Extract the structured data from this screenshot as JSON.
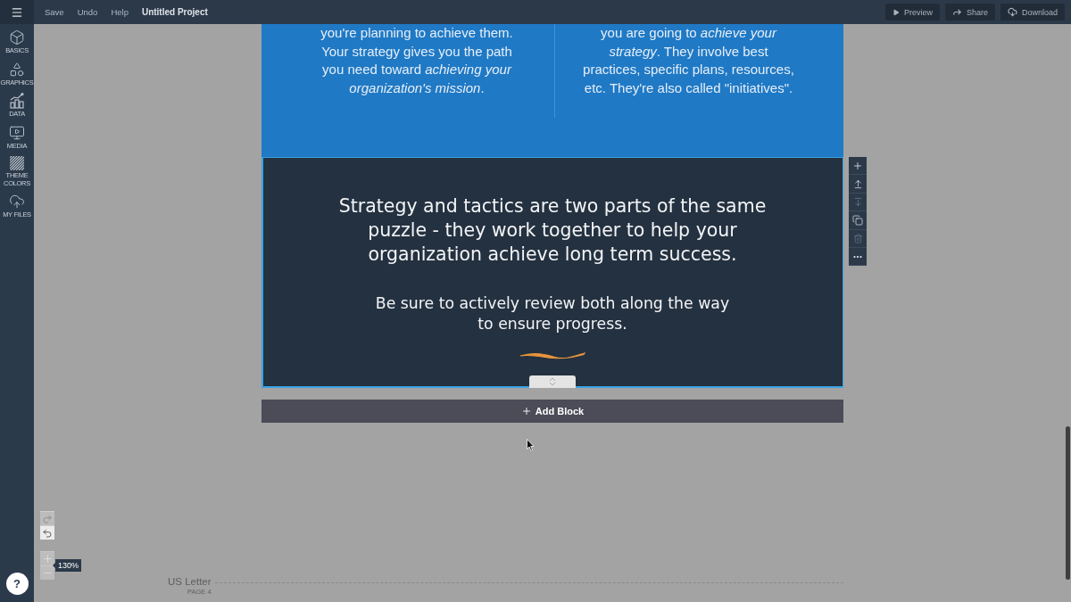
{
  "top_bar": {
    "menu": [
      {
        "label": "Save"
      },
      {
        "label": "Undo"
      },
      {
        "label": "Help"
      }
    ],
    "project_title": "Untitled Project",
    "actions": [
      {
        "kind": "preview",
        "label": "Preview"
      },
      {
        "kind": "share",
        "label": "Share"
      },
      {
        "kind": "download",
        "label": "Download"
      }
    ]
  },
  "sidebar": {
    "items": [
      {
        "kind": "basics",
        "label": "BASICS"
      },
      {
        "kind": "graphics",
        "label": "GRAPHICS"
      },
      {
        "kind": "data",
        "label": "DATA"
      },
      {
        "kind": "media",
        "label": "MEDIA"
      },
      {
        "kind": "theme_colors",
        "label": "THEME COLORS"
      },
      {
        "kind": "my_files",
        "label": "MY FILES"
      }
    ],
    "help_button": {
      "label": "?"
    }
  },
  "blocks": [
    {
      "kind": "two_column",
      "selected": false,
      "columns": [
        {
          "lines": [
            "you're planning to achieve them.",
            "Your strategy gives you the path",
            "you need toward *achieving your*",
            "*organization's mission*."
          ]
        },
        {
          "lines": [
            "you are going to *achieve your*",
            "*strategy*. They involve best",
            "practices, specific plans, resources,",
            "etc. They're also called \"initiatives\"."
          ]
        }
      ]
    },
    {
      "kind": "callout",
      "selected": true,
      "paragraphs": [
        {
          "kind": "lead",
          "lines": [
            "Strategy and tactics are two parts of the same",
            "puzzle - they work together to help your",
            "organization achieve long term success."
          ]
        },
        {
          "kind": "note",
          "lines": [
            "Be sure to actively review both along the way",
            "to ensure progress."
          ]
        }
      ]
    }
  ],
  "block_toolbar": [
    {
      "kind": "add",
      "disabled": false
    },
    {
      "kind": "move_up",
      "disabled": false
    },
    {
      "kind": "move_down",
      "disabled": true
    },
    {
      "kind": "duplicate",
      "disabled": false
    },
    {
      "kind": "delete",
      "disabled": true
    },
    {
      "kind": "more",
      "disabled": false
    }
  ],
  "add_block": {
    "label": "Add Block"
  },
  "history": [
    {
      "kind": "redo",
      "disabled": true
    },
    {
      "kind": "undo",
      "disabled": false
    }
  ],
  "zoom": {
    "value": "130%"
  },
  "page_label": {
    "size": "US Letter",
    "page": "PAGE 4"
  }
}
